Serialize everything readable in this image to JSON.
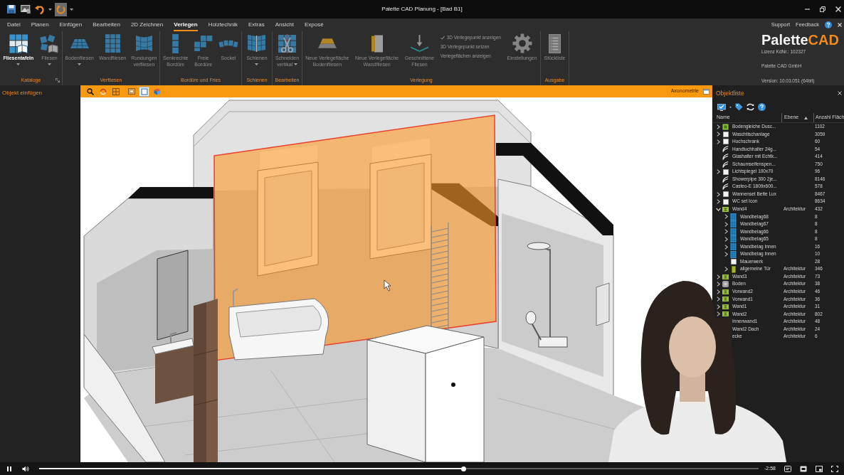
{
  "title_bar": {
    "quick_access": [
      {
        "kind": "save",
        "highlighted": false
      },
      {
        "kind": "image",
        "highlighted": false
      },
      {
        "kind": "undo",
        "highlighted": false
      },
      {
        "kind": "caret",
        "highlighted": false
      },
      {
        "kind": "refresh",
        "highlighted": true
      },
      {
        "kind": "caret",
        "highlighted": false
      }
    ],
    "title": "Palette CAD Planung - [Bad B1]"
  },
  "menu": {
    "tabs": [
      {
        "label": "Datei",
        "selected": false
      },
      {
        "label": "Planen",
        "selected": false
      },
      {
        "label": "Einfügen",
        "selected": false
      },
      {
        "label": "Bearbeiten",
        "selected": false
      },
      {
        "label": "2D Zeichnen",
        "selected": false
      },
      {
        "label": "Verlegen",
        "selected": true
      },
      {
        "label": "Holztechnik",
        "selected": false
      },
      {
        "label": "Extras",
        "selected": false
      },
      {
        "label": "Ansicht",
        "selected": false
      },
      {
        "label": "Exposé",
        "selected": false
      }
    ],
    "links": [
      "Support",
      "Feedback"
    ]
  },
  "ribbon": {
    "groups": [
      {
        "label": "Kataloge",
        "launcher": true,
        "items": [
          {
            "kind": "tile-panels",
            "label": "Fliesentafeln",
            "disabled": false,
            "dropdown": true
          },
          {
            "kind": "tile-book",
            "label": "Fliesen",
            "disabled": true,
            "dropdown": true
          }
        ]
      },
      {
        "label": "Verfliesen",
        "launcher": false,
        "items": [
          {
            "kind": "floor-tiles",
            "label": "Bodenfliesen",
            "disabled": true,
            "dropdown": true
          },
          {
            "kind": "wall-tiles",
            "label": "Wandfliesen",
            "disabled": true,
            "dropdown": false
          },
          {
            "kind": "curved-tiles",
            "label": "Rundungen\nverfliesen",
            "disabled": true,
            "dropdown": false
          }
        ]
      },
      {
        "label": "Bordüre und Fries",
        "launcher": false,
        "items": [
          {
            "kind": "vertical-border",
            "label": "Senkrechte\nBordüre",
            "disabled": true,
            "dropdown": false
          },
          {
            "kind": "free-border",
            "label": "Freie\nBordüre",
            "disabled": true,
            "dropdown": false
          },
          {
            "kind": "skirting",
            "label": "Sockel",
            "disabled": true,
            "dropdown": false
          }
        ]
      },
      {
        "label": "Schienen",
        "launcher": false,
        "items": [
          {
            "kind": "rails",
            "label": "Schienen",
            "disabled": true,
            "dropdown": true
          }
        ]
      },
      {
        "label": "Bearbeiten",
        "launcher": false,
        "items": [
          {
            "kind": "cut-vertical",
            "label": "Schneiden\nvertikal",
            "disabled": true,
            "dropdown": true
          }
        ]
      },
      {
        "label": "Verlegung",
        "launcher": false,
        "items": [
          {
            "kind": "floor-surface",
            "label": "Neue Verlegefläche\nBodenfliesen",
            "disabled": true,
            "dropdown": false
          },
          {
            "kind": "wall-surface",
            "label": "Neue Verlegefläche\nWandfliesen",
            "disabled": true,
            "dropdown": false
          },
          {
            "kind": "cut-tiles",
            "label": "Geschnittene\nFliesen",
            "disabled": true,
            "dropdown": false
          },
          {
            "kind": "checklist",
            "options": [
              {
                "label": "3D Verlegepunkt anzeigen",
                "checked": true
              },
              {
                "label": "3D Verlegepunkt setzen",
                "checked": false
              },
              {
                "label": "Verlegeflächen anzeigen",
                "checked": false
              }
            ]
          },
          {
            "kind": "settings",
            "label": "Einstellungen",
            "disabled": true,
            "dropdown": false
          }
        ]
      },
      {
        "label": "Ausgabe",
        "launcher": false,
        "items": [
          {
            "kind": "parts-list",
            "label": "Stückliste",
            "disabled": true,
            "dropdown": false
          }
        ]
      }
    ]
  },
  "brand": {
    "name_left": "Palette",
    "name_right": "CAD",
    "license": "Lizenz KdNr.: 102327",
    "company": "Palette CAD GmbH",
    "version": "Version: 10.03.051 (64bit)"
  },
  "left_panel": {
    "title": "Objekt einfügen"
  },
  "viewport": {
    "tools": [
      {
        "kind": "zoom",
        "selected": false
      },
      {
        "kind": "orbit",
        "selected": false
      },
      {
        "kind": "grid",
        "selected": false
      },
      {
        "kind": "frame",
        "selected": false
      },
      {
        "kind": "box",
        "selected": true
      },
      {
        "kind": "cube",
        "selected": false
      }
    ],
    "view_label": "Axonometrie"
  },
  "object_list": {
    "title": "Objektliste",
    "columns": [
      {
        "label": "Name",
        "sorted": false
      },
      {
        "label": "Ebene",
        "sorted": true
      },
      {
        "label": "Anzahl Fläch"
      }
    ],
    "rows": [
      {
        "name": "Bodengleiche Dusc...",
        "count": "1102",
        "kind": "tray",
        "expanded": false
      },
      {
        "name": "Waschtischanlage",
        "count": "3059",
        "kind": "box",
        "expanded": false
      },
      {
        "name": "Hochschrank",
        "count": "60",
        "kind": "box",
        "expanded": false
      },
      {
        "name": "Handtuchhalter 24g...",
        "count": "54",
        "kind": "hook"
      },
      {
        "name": "Glashalter mit Echtk...",
        "count": "414",
        "kind": "hook"
      },
      {
        "name": "Schaumseifenspen...",
        "count": "750",
        "kind": "hook"
      },
      {
        "name": "Lichtspiegel 100x70",
        "count": "96",
        "kind": "box",
        "expanded": false
      },
      {
        "name": "Showerpipe 300 2je...",
        "count": "8146",
        "kind": "hook"
      },
      {
        "name": "Casteo-E 1809x600...",
        "count": "578",
        "kind": "hook"
      },
      {
        "name": "Wannenset Bette Lux",
        "count": "8467",
        "kind": "box",
        "expanded": false
      },
      {
        "name": "WC set Icon",
        "count": "8634",
        "kind": "box",
        "expanded": false
      },
      {
        "name": "Wand4",
        "layer": "Architektur",
        "count": "432",
        "kind": "wall",
        "expanded": true,
        "children": [
          {
            "name": "Wandbelag68",
            "count": "8",
            "kind": "tiles",
            "expanded": false
          },
          {
            "name": "Wandbelag67",
            "count": "8",
            "kind": "tiles",
            "expanded": false
          },
          {
            "name": "Wandbelag66",
            "count": "8",
            "kind": "tiles",
            "expanded": false
          },
          {
            "name": "Wandbelag65",
            "count": "8",
            "kind": "tiles",
            "expanded": false
          },
          {
            "name": "Wandbelag Innen",
            "count": "16",
            "kind": "tiles",
            "expanded": false
          },
          {
            "name": "Wandbelag Innen",
            "count": "10",
            "kind": "tiles",
            "expanded": false
          },
          {
            "name": "Mauerwerk",
            "count": "28",
            "kind": "box"
          },
          {
            "name": "allgemeine Tür",
            "layer": "Architektur",
            "count": "346",
            "kind": "door",
            "expanded": false
          }
        ]
      },
      {
        "name": "Wand3",
        "layer": "Architektur",
        "count": "73",
        "kind": "wall",
        "expanded": false
      },
      {
        "name": "Boden",
        "layer": "Architektur",
        "count": "38",
        "kind": "floor",
        "expanded": false
      },
      {
        "name": "Vorwand2",
        "layer": "Architektur",
        "count": "46",
        "kind": "wall",
        "expanded": false
      },
      {
        "name": "Vorwand1",
        "layer": "Architektur",
        "count": "36",
        "kind": "wall",
        "expanded": false
      },
      {
        "name": "Wand1",
        "layer": "Architektur",
        "count": "31",
        "kind": "wall",
        "expanded": false
      },
      {
        "name": "Wand2",
        "layer": "Architektur",
        "count": "802",
        "kind": "wall",
        "expanded": false
      },
      {
        "name": "Innenwand1",
        "layer": "Architektur",
        "count": "48"
      },
      {
        "name": "Wand2 Dach",
        "layer": "Architektur",
        "count": "24"
      },
      {
        "name": "ecke",
        "layer": "Architektur",
        "count": "6"
      }
    ]
  },
  "player": {
    "playing": true,
    "progress": {
      "level": 0.59
    },
    "time": "-2:58"
  }
}
